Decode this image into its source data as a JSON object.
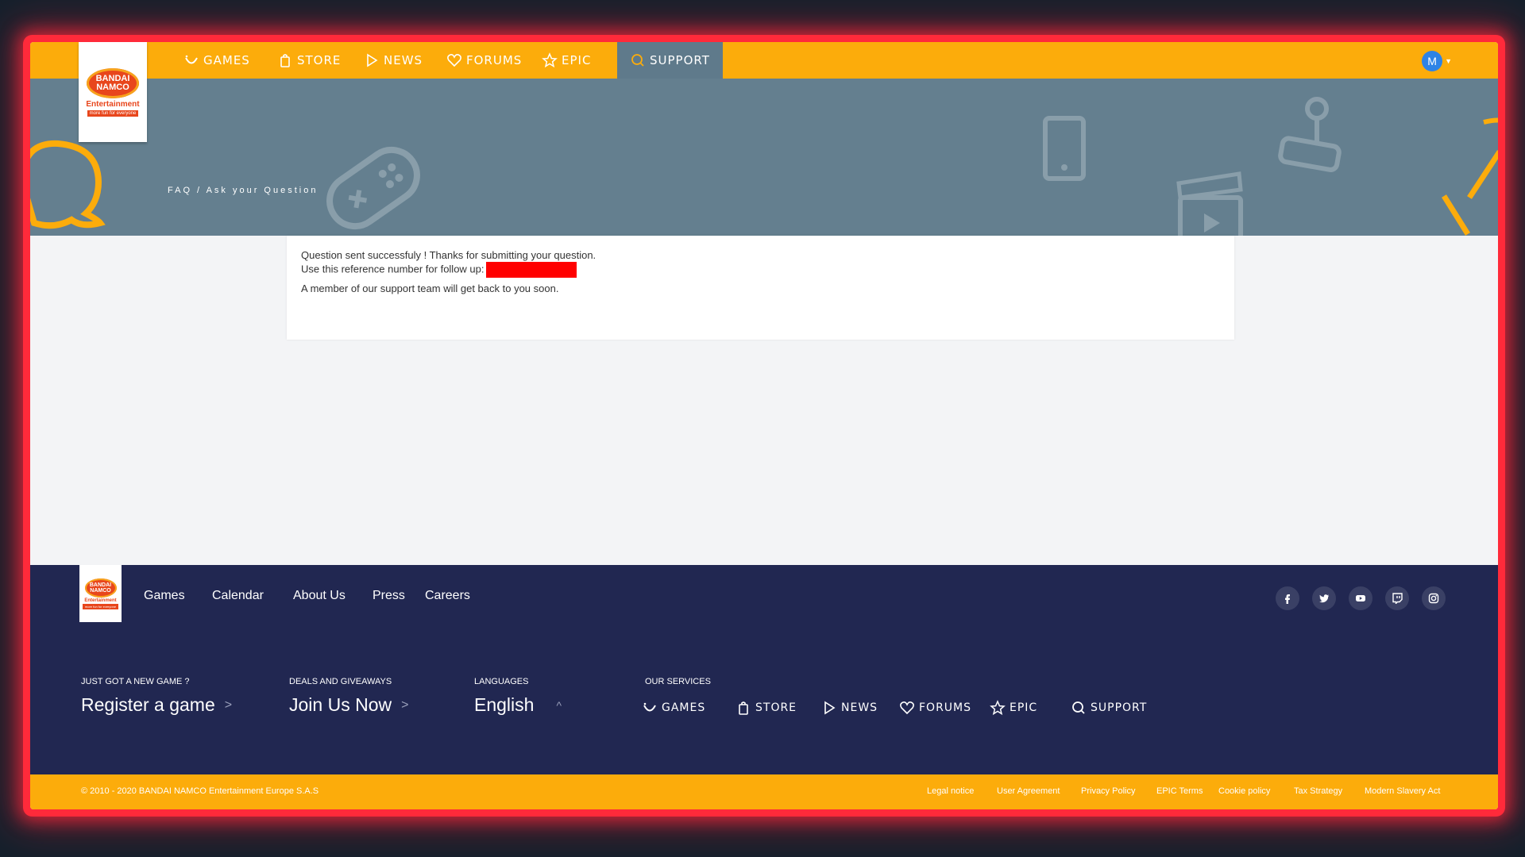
{
  "nav": {
    "items": [
      {
        "label": "GAMeS",
        "icon": "smile-icon"
      },
      {
        "label": "STORE",
        "icon": "shopping-bag-icon"
      },
      {
        "label": "NeWS",
        "icon": "play-icon"
      },
      {
        "label": "FORUMS",
        "icon": "heart-icon"
      },
      {
        "label": "EPIC",
        "icon": "star-icon"
      },
      {
        "label": "SUPPORT",
        "icon": "search-icon"
      }
    ],
    "active": "SUPPORT",
    "avatar_initial": "M"
  },
  "logo": {
    "brand_line1": "BANDAI",
    "brand_line2": "NAMCO",
    "entertainment": "Entertainment",
    "tagline": "more fun for everyone"
  },
  "breadcrumb": "FAQ / Ask your Question",
  "message": {
    "line1": "Question sent successfuly ! Thanks for submitting your question.",
    "line2": "Use this reference number for follow up:",
    "line3": "A member of our support team will get back to you soon."
  },
  "footer": {
    "links": [
      "Games",
      "Calendar",
      "About Us",
      "Press",
      "Careers"
    ],
    "social": [
      "facebook-icon",
      "twitter-icon",
      "youtube-icon",
      "twitch-icon",
      "instagram-icon"
    ],
    "register": {
      "small": "JUST GOT A NEW GAME ?",
      "big": "Register a game"
    },
    "deals": {
      "small": "DEALS AND GIVEAWAYS",
      "big": "Join Us Now"
    },
    "languages": {
      "small": "LANGUAGES",
      "big": "English"
    },
    "services_label": "OUR SERVICES",
    "services": [
      {
        "label": "GAMeS",
        "icon": "smile-icon"
      },
      {
        "label": "STORE",
        "icon": "shopping-bag-icon"
      },
      {
        "label": "NeWS",
        "icon": "play-icon"
      },
      {
        "label": "FORUMS",
        "icon": "heart-icon"
      },
      {
        "label": "EPIC",
        "icon": "star-icon"
      },
      {
        "label": "SUPPORT",
        "icon": "search-icon"
      }
    ]
  },
  "bottom": {
    "copyright": "© 2010 - 2020 BANDAI NAMCO Entertainment Europe S.A.S",
    "legal": [
      "Legal notice",
      "User Agreement",
      "Privacy Policy",
      "EPIC Terms",
      "Cookie policy",
      "Tax Strategy",
      "Modern Slavery Act"
    ]
  },
  "colors": {
    "accent": "#fcac0b",
    "hero": "#647f8f",
    "footer": "#212751",
    "frame": "#ff2a3a"
  }
}
